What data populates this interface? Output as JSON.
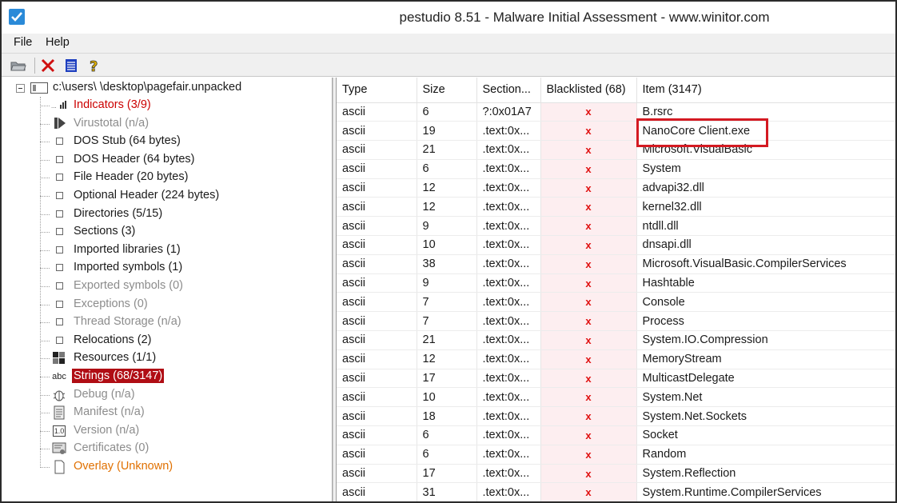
{
  "window": {
    "title": "pestudio 8.51 - Malware Initial Assessment - www.winitor.com",
    "app_icon": "checkbox-app-icon",
    "accent_color": "#2a8ad8"
  },
  "menu": {
    "file": "File",
    "help": "Help"
  },
  "toolbar": {
    "icons": [
      "open-folder-icon",
      "delete-icon",
      "list-icon",
      "help-icon"
    ]
  },
  "tree": {
    "root_label": "c:\\users\\             \\desktop\\pagefair.unpacked",
    "items": [
      {
        "label": "Indicators (3/9)",
        "icon": "chart-icon",
        "style": "red"
      },
      {
        "label": "Virustotal (n/a)",
        "icon": "play-icon",
        "style": "gray"
      },
      {
        "label": "DOS Stub (64 bytes)",
        "icon": "box-icon",
        "style": "normal"
      },
      {
        "label": "DOS Header (64 bytes)",
        "icon": "box-icon",
        "style": "normal"
      },
      {
        "label": "File Header (20 bytes)",
        "icon": "box-icon",
        "style": "normal"
      },
      {
        "label": "Optional Header (224 bytes)",
        "icon": "box-icon",
        "style": "normal"
      },
      {
        "label": "Directories (5/15)",
        "icon": "box-icon",
        "style": "normal"
      },
      {
        "label": "Sections (3)",
        "icon": "box-icon",
        "style": "normal"
      },
      {
        "label": "Imported libraries (1)",
        "icon": "box-icon",
        "style": "normal"
      },
      {
        "label": "Imported symbols (1)",
        "icon": "box-icon",
        "style": "normal"
      },
      {
        "label": "Exported symbols (0)",
        "icon": "box-icon",
        "style": "gray"
      },
      {
        "label": "Exceptions (0)",
        "icon": "box-icon",
        "style": "gray"
      },
      {
        "label": "Thread Storage (n/a)",
        "icon": "box-icon",
        "style": "gray"
      },
      {
        "label": "Relocations (2)",
        "icon": "box-icon",
        "style": "normal"
      },
      {
        "label": "Resources (1/1)",
        "icon": "grid-icon",
        "style": "normal"
      },
      {
        "label": "Strings (68/3147)",
        "icon": "abc-icon",
        "style": "selected"
      },
      {
        "label": "Debug (n/a)",
        "icon": "bug-icon",
        "style": "gray"
      },
      {
        "label": "Manifest (n/a)",
        "icon": "document-icon",
        "style": "gray"
      },
      {
        "label": "Version (n/a)",
        "icon": "version-icon",
        "style": "gray"
      },
      {
        "label": "Certificates (0)",
        "icon": "certificate-icon",
        "style": "gray"
      },
      {
        "label": "Overlay (Unknown)",
        "icon": "page-icon",
        "style": "orange"
      }
    ],
    "abc_text": "abc",
    "version_text": "1.0",
    "selected_color": "#b00d14"
  },
  "table": {
    "headers": [
      "Type",
      "Size",
      "Section...",
      "Blacklisted (68)",
      "Item (3147)"
    ],
    "blacklist_mark": "x",
    "rows": [
      [
        "ascii",
        "6",
        "?:0x01A7",
        "x",
        "B.rsrc"
      ],
      [
        "ascii",
        "19",
        ".text:0x...",
        "x",
        "NanoCore Client.exe"
      ],
      [
        "ascii",
        "21",
        ".text:0x...",
        "x",
        "Microsoft.VisualBasic"
      ],
      [
        "ascii",
        "6",
        ".text:0x...",
        "x",
        "System"
      ],
      [
        "ascii",
        "12",
        ".text:0x...",
        "x",
        "advapi32.dll"
      ],
      [
        "ascii",
        "12",
        ".text:0x...",
        "x",
        "kernel32.dll"
      ],
      [
        "ascii",
        "9",
        ".text:0x...",
        "x",
        "ntdll.dll"
      ],
      [
        "ascii",
        "10",
        ".text:0x...",
        "x",
        "dnsapi.dll"
      ],
      [
        "ascii",
        "38",
        ".text:0x...",
        "x",
        "Microsoft.VisualBasic.CompilerServices"
      ],
      [
        "ascii",
        "9",
        ".text:0x...",
        "x",
        "Hashtable"
      ],
      [
        "ascii",
        "7",
        ".text:0x...",
        "x",
        "Console"
      ],
      [
        "ascii",
        "7",
        ".text:0x...",
        "x",
        "Process"
      ],
      [
        "ascii",
        "21",
        ".text:0x...",
        "x",
        "System.IO.Compression"
      ],
      [
        "ascii",
        "12",
        ".text:0x...",
        "x",
        "MemoryStream"
      ],
      [
        "ascii",
        "17",
        ".text:0x...",
        "x",
        "MulticastDelegate"
      ],
      [
        "ascii",
        "10",
        ".text:0x...",
        "x",
        "System.Net"
      ],
      [
        "ascii",
        "18",
        ".text:0x...",
        "x",
        "System.Net.Sockets"
      ],
      [
        "ascii",
        "6",
        ".text:0x...",
        "x",
        "Socket"
      ],
      [
        "ascii",
        "6",
        ".text:0x...",
        "x",
        "Random"
      ],
      [
        "ascii",
        "17",
        ".text:0x...",
        "x",
        "System.Reflection"
      ],
      [
        "ascii",
        "31",
        ".text:0x...",
        "x",
        "System.Runtime.CompilerServices"
      ]
    ],
    "highlight_color": "#d41a22"
  }
}
